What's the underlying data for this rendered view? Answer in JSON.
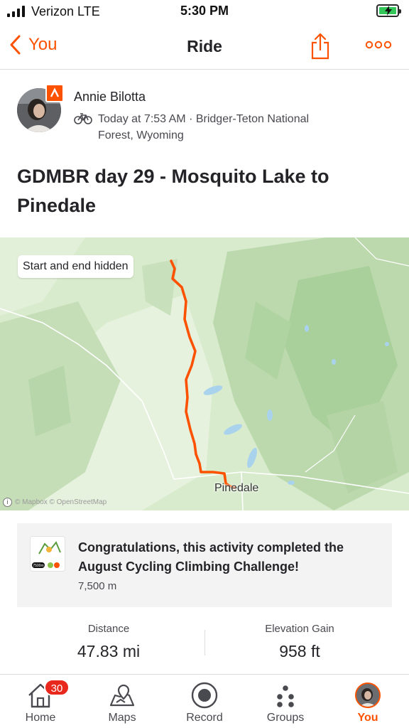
{
  "status_bar": {
    "carrier": "Verizon  LTE",
    "time": "5:30 PM"
  },
  "nav": {
    "back_label": "You",
    "title": "Ride",
    "accent": "#fc5200"
  },
  "activity": {
    "athlete_name": "Annie Bilotta",
    "meta": "Today at 7:53 AM · Bridger-Teton National Forest, Wyoming",
    "title": "GDMBR day 29 - Mosquito Lake to Pinedale"
  },
  "map": {
    "privacy_label": "Start and end hidden",
    "place_label": "Pinedale",
    "attribution": "© Mapbox © OpenStreetMap",
    "route_color": "#fc5200"
  },
  "achievement": {
    "text": "Congratulations, this activity completed the August Cycling Climbing Challenge!",
    "subtext": "7,500 m",
    "badge_text": "7500m"
  },
  "stats": [
    {
      "label": "Distance",
      "value": "47.83 mi"
    },
    {
      "label": "Elevation Gain",
      "value": "958 ft"
    }
  ],
  "tabs": [
    {
      "label": "Home",
      "icon": "home-icon",
      "badge": "30"
    },
    {
      "label": "Maps",
      "icon": "map-icon"
    },
    {
      "label": "Record",
      "icon": "record-icon"
    },
    {
      "label": "Groups",
      "icon": "groups-icon"
    },
    {
      "label": "You",
      "icon": "avatar",
      "active": true
    }
  ]
}
